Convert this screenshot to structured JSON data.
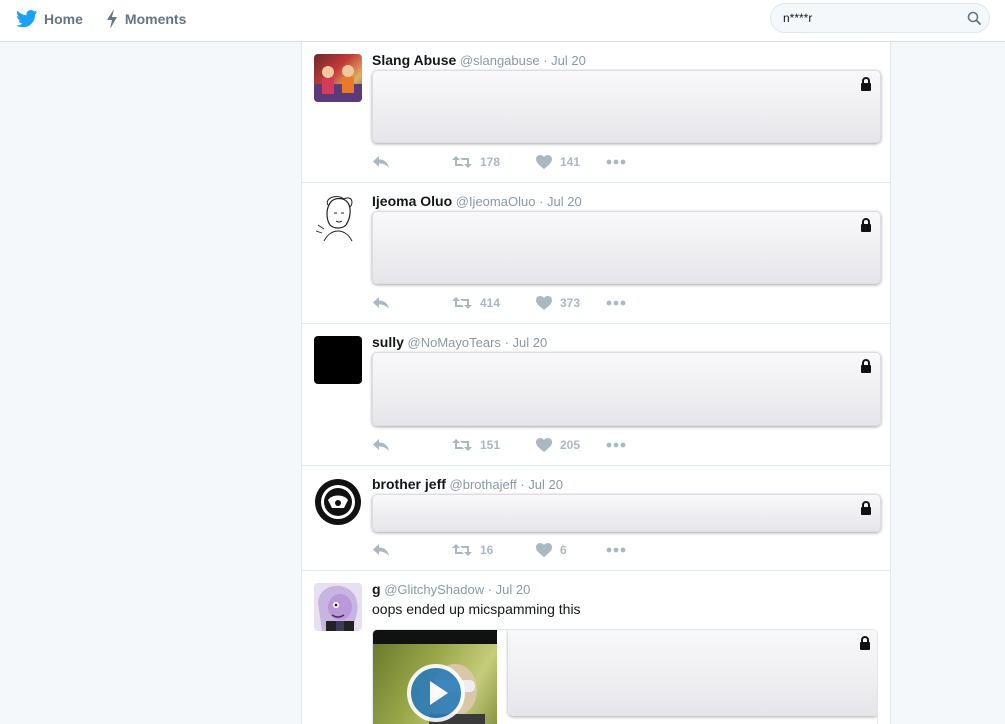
{
  "nav": {
    "home_label": "Home",
    "moments_label": "Moments"
  },
  "search": {
    "value": "n****r"
  },
  "colors": {
    "brand": "#1da1f2",
    "nav_text": "#66757f",
    "muted": "#8899a6",
    "action": "#aab8c2"
  },
  "tweets": [
    {
      "name": "Slang Abuse",
      "handle": "@slangabuse",
      "date": "· Jul 20",
      "retweets": "178",
      "likes": "141"
    },
    {
      "name": "Ijeoma Oluo",
      "handle": "@IjeomaOluo",
      "date": "· Jul 20",
      "retweets": "414",
      "likes": "373"
    },
    {
      "name": "sully",
      "handle": "@NoMayoTears",
      "date": "· Jul 20",
      "retweets": "151",
      "likes": "205"
    },
    {
      "name": "brother jeff",
      "handle": "@brothajeff",
      "date": "· Jul 20",
      "retweets": "16",
      "likes": "6"
    },
    {
      "name": "g",
      "handle": "@GlitchyShadow",
      "date": "· Jul 20",
      "text": "oops ended up micspamming this"
    }
  ]
}
